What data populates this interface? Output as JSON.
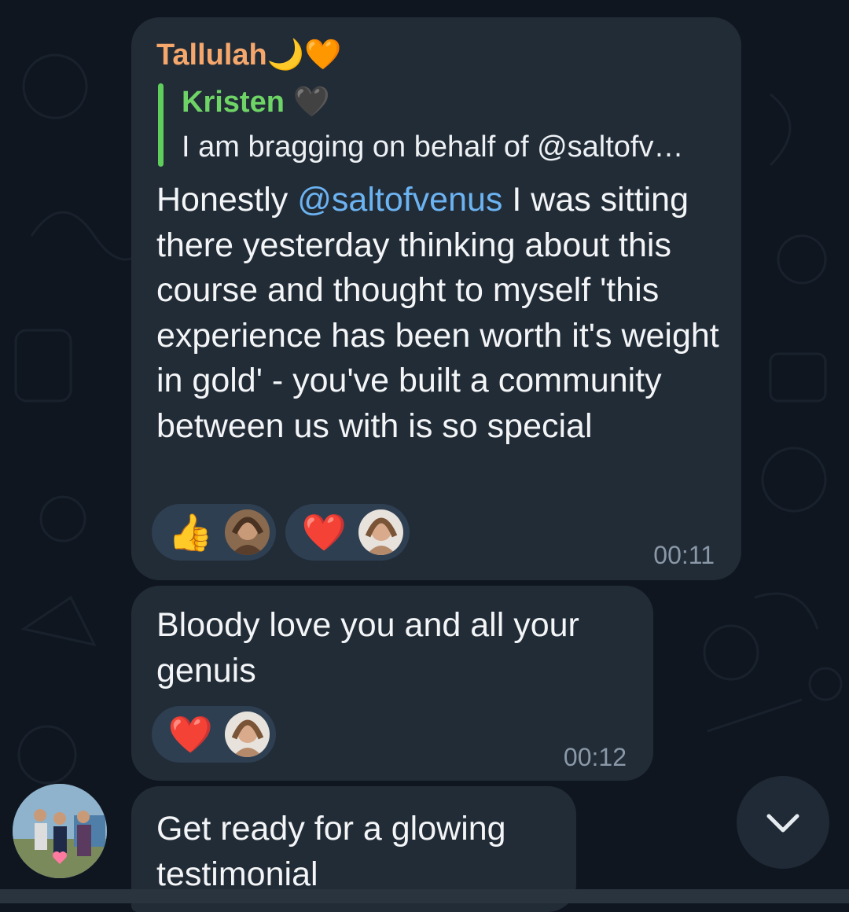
{
  "messages": [
    {
      "sender": "Tallulah",
      "sender_emoji": "🌙🧡",
      "reply": {
        "name": "Kristen",
        "name_emoji": "🖤",
        "text": "I am bragging on behalf of @saltofv…"
      },
      "text_before": "Honestly ",
      "mention": "@saltofvenus",
      "text_after": " I was sitting there yesterday thinking about this course and thought to myself 'this experience has been worth it's weight in gold' - you've built a community between us with is so special",
      "reactions": [
        {
          "emoji": "👍",
          "icon": "thumbs-up-icon"
        },
        {
          "emoji": "❤️",
          "icon": "heart-icon"
        }
      ],
      "time": "00:11"
    },
    {
      "text": "Bloody love you and all your genuis",
      "reactions": [
        {
          "emoji": "❤️",
          "icon": "heart-icon"
        }
      ],
      "time": "00:12"
    },
    {
      "text": "Get ready for a glowing testimonial"
    }
  ],
  "scroll_button": {
    "icon": "chevron-down-icon"
  },
  "colors": {
    "background": "#0f1620",
    "bubble": "#222c37",
    "sender": "#f5a76c",
    "reply": "#6ed466",
    "mention": "#6cb3f2",
    "reaction_bg": "#2f3f52",
    "time": "#8a98a8"
  }
}
